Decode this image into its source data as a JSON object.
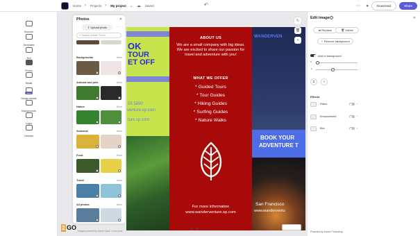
{
  "topbar": {
    "breadcrumbs": [
      "Home",
      "Projects",
      "My project"
    ],
    "save_status": "Saved",
    "download_label": "Download",
    "share_label": "Share"
  },
  "rail": {
    "items": [
      {
        "label": "Discover"
      },
      {
        "label": "Templates"
      },
      {
        "label": "Text"
      },
      {
        "label": "Photos"
      },
      {
        "label": "Media"
      },
      {
        "label": "Design assets"
      },
      {
        "label": "Backgrounds"
      },
      {
        "label": "Logos"
      },
      {
        "label": "Libraries"
      }
    ],
    "new_badge": "NEW"
  },
  "photos_panel": {
    "title": "Photos",
    "upload_label": "Upload photo",
    "search_placeholder": "Search Adobe Stock",
    "more_label": "More",
    "sections": [
      {
        "title": "Backgrounds"
      },
      {
        "title": "Animals and pets"
      },
      {
        "title": "Nature"
      },
      {
        "title": "Seasonal"
      },
      {
        "title": "Food"
      },
      {
        "title": "Travel"
      },
      {
        "title": "All photos"
      }
    ]
  },
  "document": {
    "left_col": {
      "headline1": "OK",
      "headline2": "TOUR",
      "headline3": "ET OFF",
      "phone": "55 5890",
      "website1": "venture.sp.com",
      "website2": "ture.sp.com"
    },
    "mid_col": {
      "about_title": "ABOUT US",
      "about_body": "We are a small company with big ideas. We are excited to share our passion for travel and adventure with you!",
      "offer_title": "WHAT WE OFFER",
      "offers": [
        "* Guided Tours",
        "* Tour Guides",
        "* Hiking Guides",
        "* Surfing Guides",
        "* Nature Walks"
      ],
      "info_line": "For more information",
      "website": "www.wanderventure.sp.com"
    },
    "right_col": {
      "brand": "WANDERVEN",
      "book_line1": "BOOK YOUR",
      "book_line2": "ADVENTURE T",
      "city": "San Francisco",
      "website": "www.wanderventu"
    }
  },
  "zoom": {
    "level": "67%"
  },
  "edit_panel": {
    "title": "Edit image",
    "help": "?",
    "replace_label": "Replace",
    "delete_label": "Delete",
    "remove_bg_label": "Remove background",
    "add_background_label": "Add to background",
    "add_background_on": true,
    "effects_title": "Effects",
    "effects": [
      {
        "label": "Filters",
        "on": false
      },
      {
        "label": "Enhancement",
        "on": false
      },
      {
        "label": "Blur",
        "on": false
      }
    ],
    "footer": "Powered by Adobe Photoshop"
  },
  "footer": {
    "brand_number": "2",
    "brand_word": "GO",
    "powered_left": "Images powered by Adobe Stock. Learn more"
  },
  "colors": {
    "accent": "#5b5bd6",
    "red_panel": "#a80a0a",
    "lime": "#c7e44d",
    "blue_text": "#2b2ed8"
  }
}
